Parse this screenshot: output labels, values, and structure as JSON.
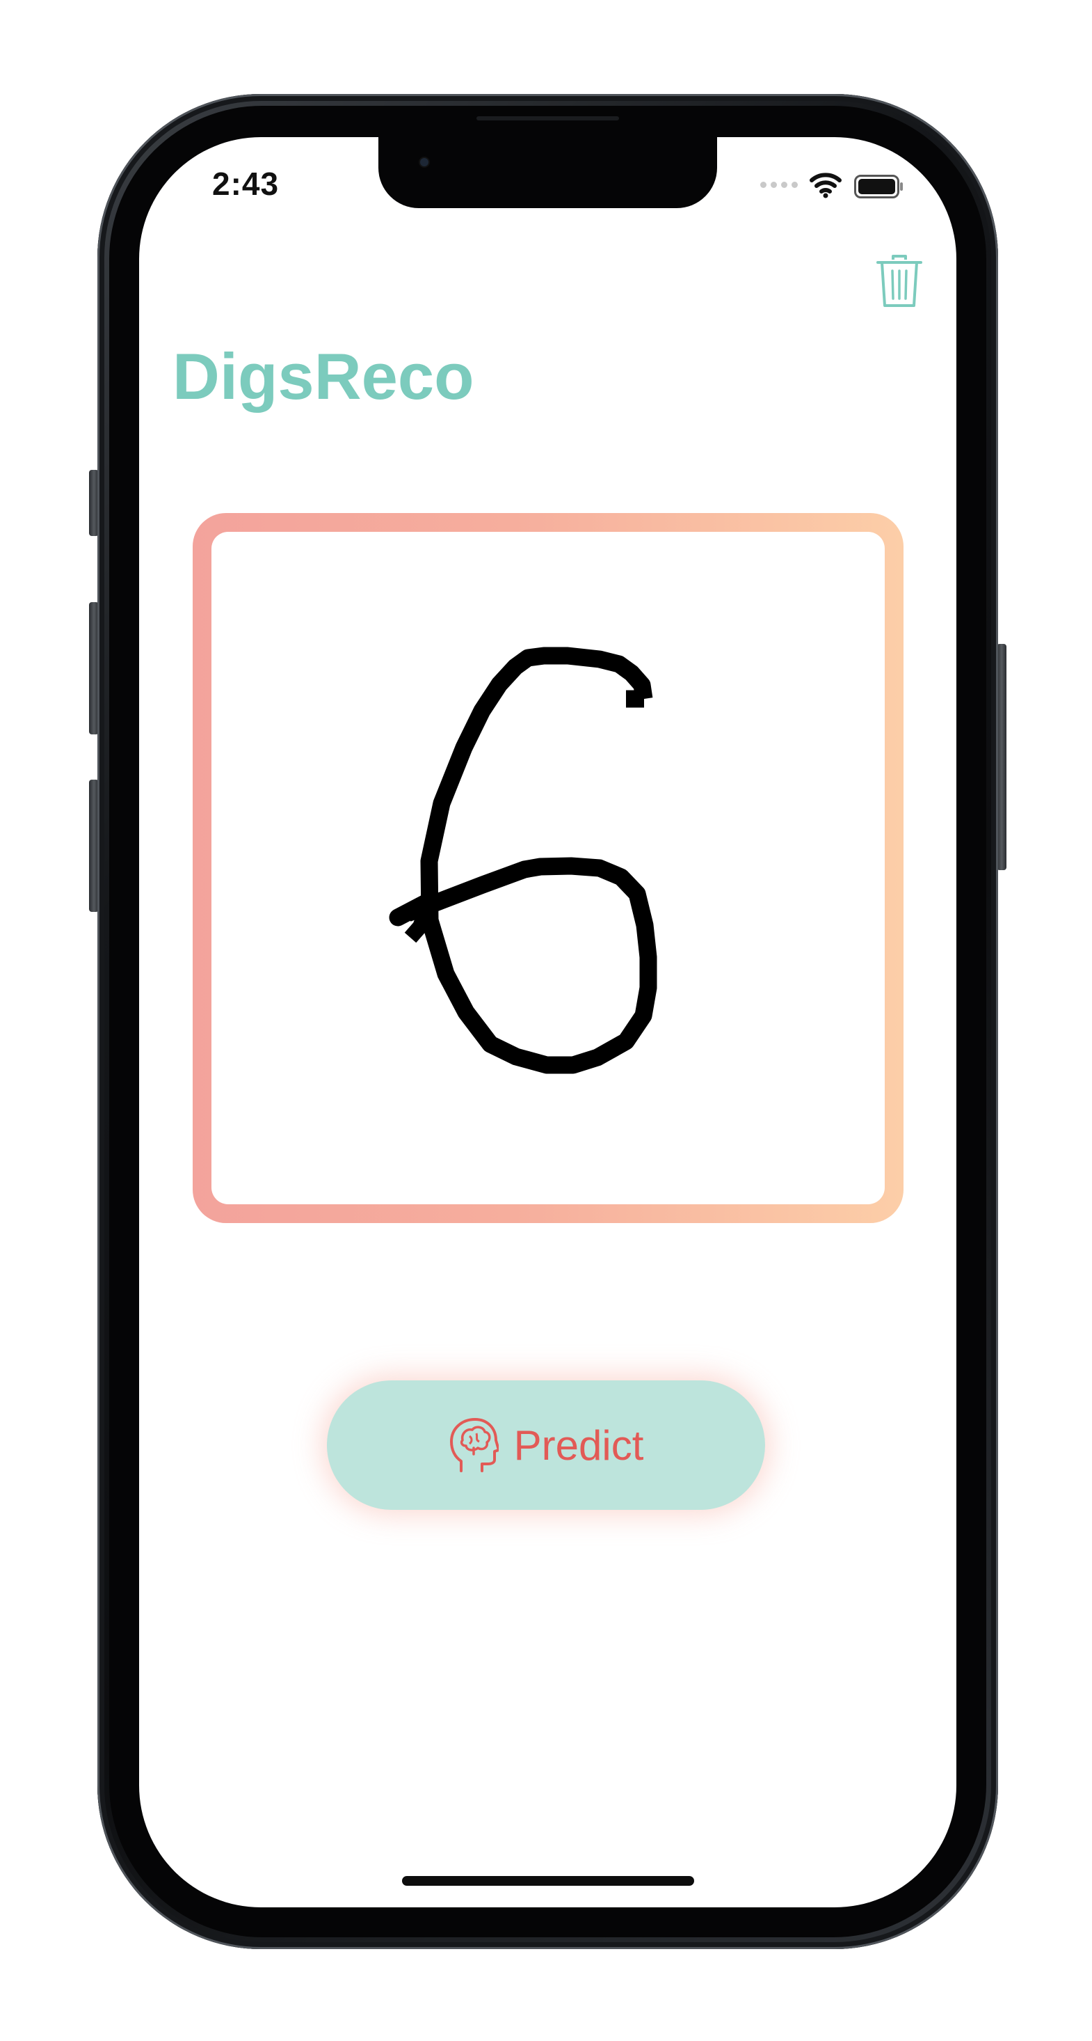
{
  "status_bar": {
    "time": "2:43"
  },
  "header": {
    "app_title": "DigsReco",
    "clear_icon": "trash-icon"
  },
  "canvas": {
    "drawn_content": "6",
    "border_gradient": [
      "#f3a39c",
      "#fccea8"
    ]
  },
  "actions": {
    "predict_label": "Predict",
    "predict_icon": "brain-head-icon"
  },
  "colors": {
    "accent_teal": "#7ccbbd",
    "button_fill": "#bde4dc",
    "button_text": "#e25a56",
    "stroke": "#000000"
  }
}
